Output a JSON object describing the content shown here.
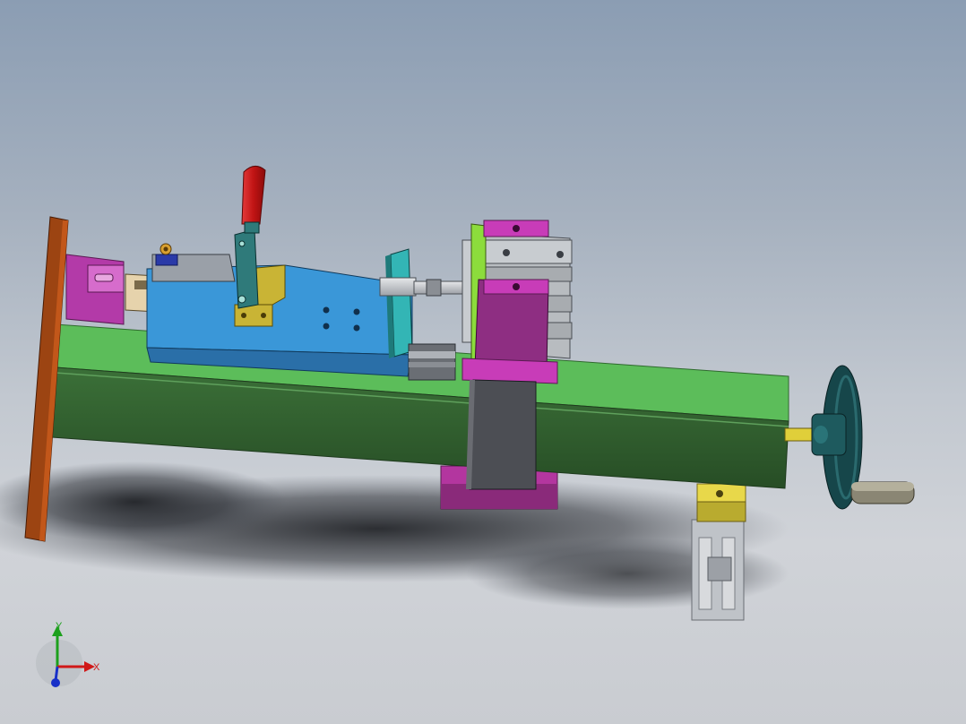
{
  "viewport": {
    "background_top": "#8b9db3",
    "background_bottom": "#c9ccd1"
  },
  "triad": {
    "x_label": "X",
    "y_label": "Y",
    "x_color": "#d01818",
    "y_color": "#1ca01c",
    "z_color": "#1830c8"
  },
  "colors": {
    "base_rail": "#5cbd5a",
    "base_rail_dark": "#2f5c2d",
    "end_plate": "#b04a12",
    "blue_plate": "#3794d6",
    "magenta": "#c83cb8",
    "clamp_handle": "#c81818",
    "handwheel": "#16464a",
    "yellow": "#e0d040"
  }
}
